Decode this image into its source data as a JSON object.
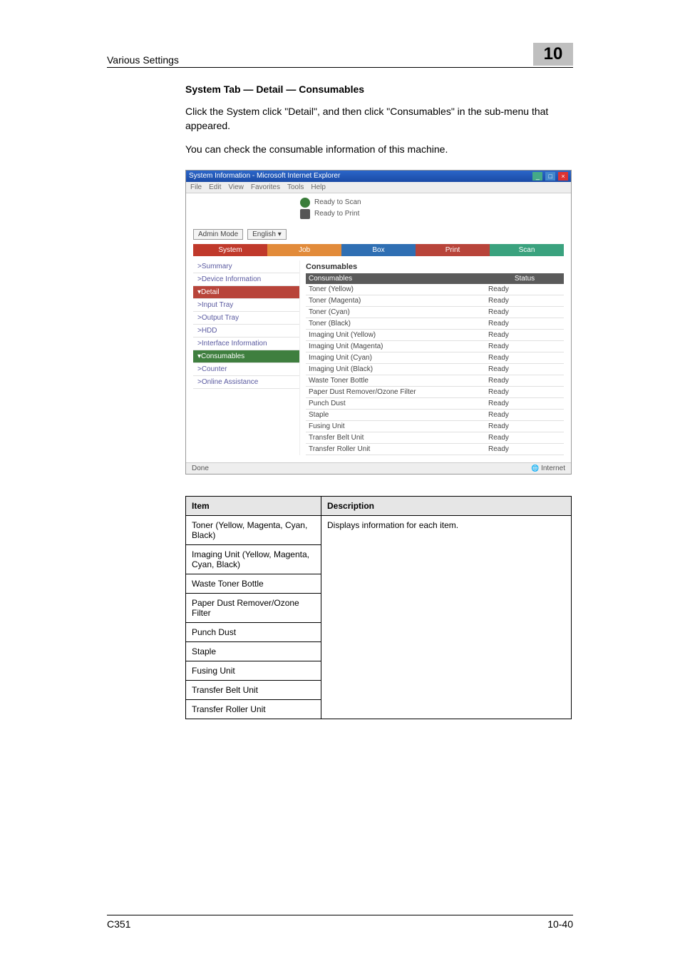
{
  "header": {
    "section": "Various Settings",
    "chapter_number": "10"
  },
  "section_title": "System Tab — Detail — Consumables",
  "paragraphs": {
    "p1": "Click the System click \"Detail\", and then click \"Consumables\" in the sub-menu that appeared.",
    "p2": "You can check the consumable information of this machine."
  },
  "screenshot": {
    "window_title": "System Information - Microsoft Internet Explorer",
    "menu": [
      "File",
      "Edit",
      "View",
      "Favorites",
      "Tools",
      "Help"
    ],
    "status_scan": "Ready to Scan",
    "status_print": "Ready to Print",
    "admin_mode": "Admin Mode",
    "language": "English",
    "tabs": {
      "system": "System",
      "job": "Job",
      "box": "Box",
      "print": "Print",
      "scan": "Scan"
    },
    "side_items": {
      "summary": ">Summary",
      "device_info": ">Device Information",
      "detail": "▾Detail",
      "input_tray": ">Input Tray",
      "output_tray": ">Output Tray",
      "hdd": ">HDD",
      "interface_info": ">Interface Information",
      "consumables": "▾Consumables",
      "counter": ">Counter",
      "online_assist": ">Online Assistance"
    },
    "panel_heading": "Consumables",
    "table_header": {
      "consumables": "Consumables",
      "status": "Status"
    },
    "ready": "Ready",
    "rows": [
      "Toner (Yellow)",
      "Toner (Magenta)",
      "Toner (Cyan)",
      "Toner (Black)",
      "Imaging Unit (Yellow)",
      "Imaging Unit (Magenta)",
      "Imaging Unit (Cyan)",
      "Imaging Unit (Black)",
      "Waste Toner Bottle",
      "Paper Dust Remover/Ozone Filter",
      "Punch Dust",
      "Staple",
      "Fusing Unit",
      "Transfer Belt Unit",
      "Transfer Roller Unit"
    ],
    "footer_left": "Done",
    "footer_right": "Internet"
  },
  "desc_table": {
    "header_item": "Item",
    "header_desc": "Description",
    "desc_text": "Displays information for each item.",
    "items": [
      "Toner (Yellow, Magenta, Cyan, Black)",
      "Imaging Unit (Yellow, Magenta, Cyan, Black)",
      "Waste Toner Bottle",
      "Paper Dust Remover/Ozone Filter",
      "Punch Dust",
      "Staple",
      "Fusing Unit",
      "Transfer Belt Unit",
      "Transfer Roller Unit"
    ]
  },
  "footer": {
    "left": "C351",
    "right": "10-40"
  }
}
